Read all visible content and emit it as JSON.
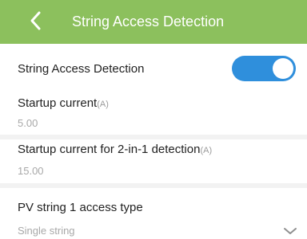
{
  "header": {
    "title": "String Access Detection",
    "back_icon": "chevron-left-icon"
  },
  "colors": {
    "header_bg": "#8cc05d",
    "toggle_on": "#2f8fdc"
  },
  "detection": {
    "label": "String Access Detection",
    "enabled": true
  },
  "startup_current": {
    "label": "Startup current",
    "unit": "(A)",
    "value": "5.00"
  },
  "startup_current_2in1": {
    "label": "Startup current for 2-in-1 detection",
    "unit": "(A)",
    "value": "15.00"
  },
  "pv_string_1": {
    "label": "PV string 1 access type",
    "value": "Single string",
    "dropdown_icon": "chevron-down-icon"
  }
}
